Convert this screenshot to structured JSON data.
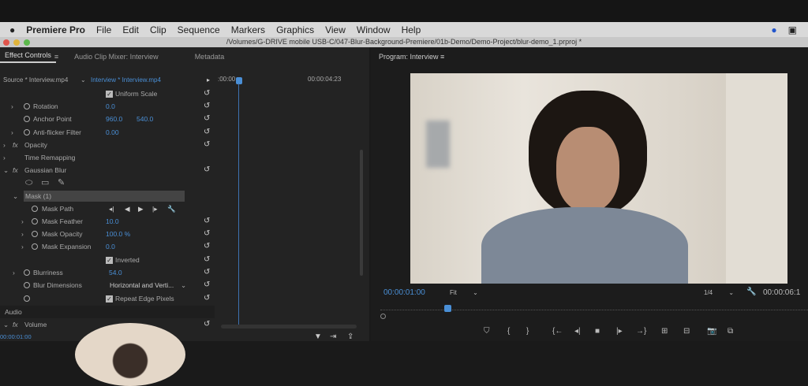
{
  "menubar": {
    "apple": "",
    "app": "Premiere Pro",
    "items": [
      "File",
      "Edit",
      "Clip",
      "Sequence",
      "Markers",
      "Graphics",
      "View",
      "Window",
      "Help"
    ]
  },
  "titlebar": {
    "path": "/Volumes/G-DRIVE mobile USB-C/047-Blur-Background-Premiere/01b-Demo/Demo-Project/blur-demo_1.prproj *"
  },
  "left": {
    "tabs": [
      "Effect Controls",
      "Audio Clip Mixer: Interview",
      "Metadata"
    ],
    "source": "Source * Interview.mp4",
    "clip": "Interview * Interview.mp4",
    "tc_start": ":00:00",
    "tc_end": "00:00:04:23",
    "uniform_scale": "Uniform Scale",
    "rotation": {
      "label": "Rotation",
      "value": "0.0"
    },
    "anchor": {
      "label": "Anchor Point",
      "x": "960.0",
      "y": "540.0"
    },
    "antiflicker": {
      "label": "Anti-flicker Filter",
      "value": "0.00"
    },
    "opacity": "Opacity",
    "time_remap": "Time Remapping",
    "gblur": "Gaussian Blur",
    "mask": "Mask (1)",
    "mask_path": "Mask Path",
    "feather": {
      "label": "Mask Feather",
      "value": "10.0"
    },
    "mopacity": {
      "label": "Mask Opacity",
      "value": "100.0 %"
    },
    "expansion": {
      "label": "Mask Expansion",
      "value": "0.0"
    },
    "inverted": "Inverted",
    "blurriness": {
      "label": "Blurriness",
      "value": "54.0"
    },
    "blurdim": {
      "label": "Blur Dimensions",
      "value": "Horizontal and Verti..."
    },
    "repeat": "Repeat Edge Pixels",
    "audio": "Audio",
    "volume": "Volume",
    "timecode": "00:00:01:00"
  },
  "program": {
    "title": "Program: Interview",
    "timecode": "00:00:01:00",
    "fit": "Fit",
    "resolution": "1/4",
    "duration": "00:00:06:1"
  },
  "fx": "fx"
}
